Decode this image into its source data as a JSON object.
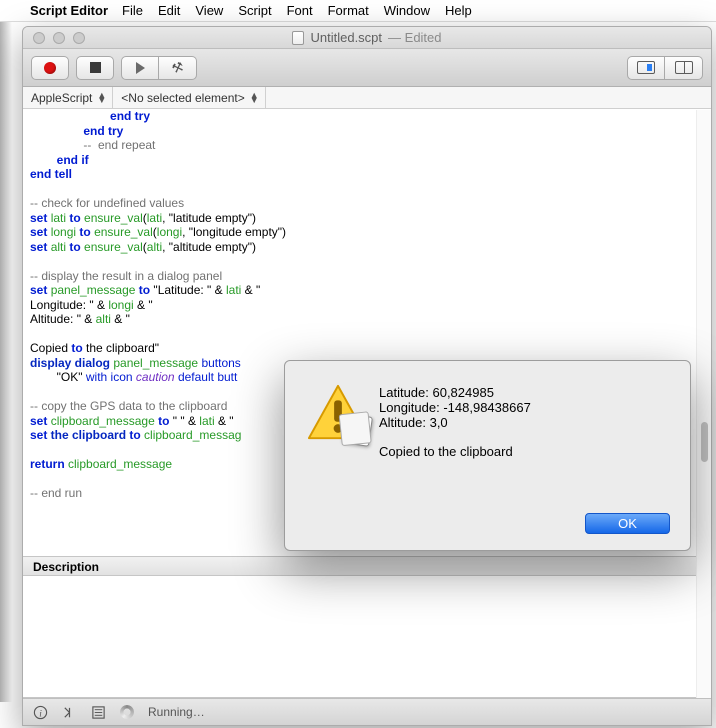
{
  "menubar": {
    "app": "Script Editor",
    "items": [
      "File",
      "Edit",
      "View",
      "Script",
      "Font",
      "Format",
      "Window",
      "Help"
    ]
  },
  "window": {
    "title": "Untitled.scpt",
    "edited": "— Edited"
  },
  "selector": {
    "language": "AppleScript",
    "element": "<No selected element>"
  },
  "code_lines": [
    "                        end try",
    "                end try",
    "                --  end repeat",
    "        end if",
    "end tell",
    "",
    "-- check for undefined values",
    "set lati to ensure_val(lati, \"latitude empty\")",
    "set longi to ensure_val(longi, \"longitude empty\")",
    "set alti to ensure_val(alti, \"altitude empty\")",
    "",
    "-- display the result in a dialog panel",
    "set panel_message to \"Latitude: \" & lati & \"",
    "Longitude: \" & longi & \"",
    "Altitude: \" & alti & \"",
    "",
    "Copied to the clipboard\"",
    "display dialog panel_message buttons",
    "        \"OK\" with icon caution default butt",
    "",
    "-- copy the GPS data to the clipboard",
    "set clipboard_message to \" \" & lati & \"",
    "set the clipboard to clipboard_messag",
    "",
    "return clipboard_message",
    "",
    "-- end run"
  ],
  "desc_header": "Description",
  "status": {
    "text": "Running…"
  },
  "dialog": {
    "line1": "Latitude: 60,824985",
    "line2": "Longitude: -148,98438667",
    "line3": "Altitude: 3,0",
    "line4": "Copied to the clipboard",
    "ok": "OK"
  }
}
